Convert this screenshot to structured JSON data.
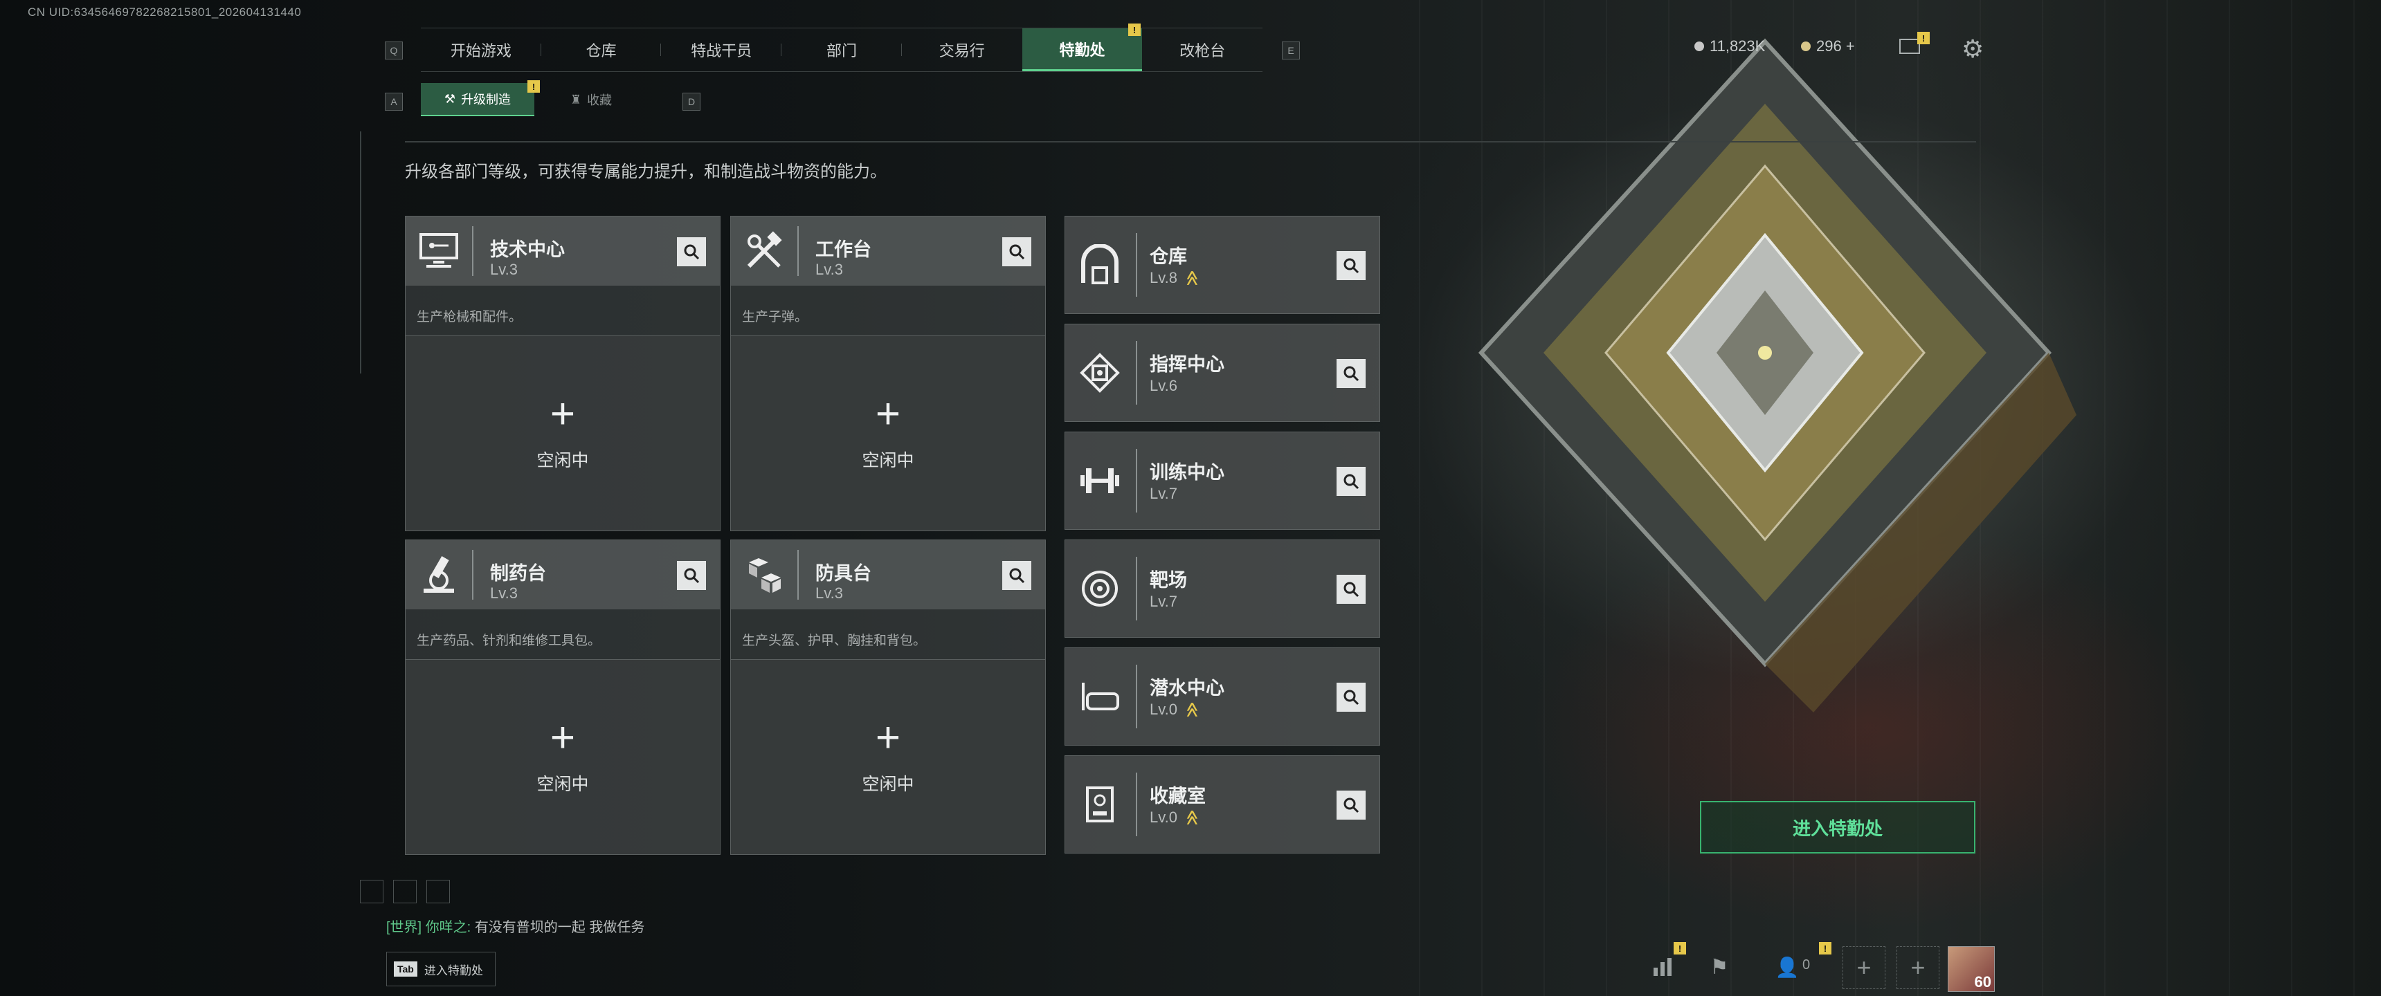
{
  "uid_text": "CN UID:63456469782268215801_202604131440",
  "nav": {
    "left_key": "Q",
    "right_key": "E",
    "tabs": [
      "开始游戏",
      "仓库",
      "特战干员",
      "部门",
      "交易行",
      "特勤处",
      "改枪台"
    ],
    "active_tab": "特勤处",
    "badge": "!"
  },
  "subnav": {
    "left_key": "A",
    "right_key": "D",
    "tabs": [
      "升级制造",
      "收藏"
    ],
    "badge": "!"
  },
  "description": "升级各部门等级，可获得专属能力提升，和制造战斗物资的能力。",
  "craft_stations": [
    {
      "name": "技术中心",
      "level": "Lv.3",
      "note": "生产枪械和配件。",
      "icon": "monitor-icon",
      "slot": "空闲中"
    },
    {
      "name": "工作台",
      "level": "Lv.3",
      "note": "生产子弹。",
      "icon": "tools-icon",
      "slot": "空闲中"
    },
    {
      "name": "制药台",
      "level": "Lv.3",
      "note": "生产药品、针剂和维修工具包。",
      "icon": "microscope-icon",
      "slot": "空闲中"
    },
    {
      "name": "防具台",
      "level": "Lv.3",
      "note": "生产头盔、护甲、胸挂和背包。",
      "icon": "cubes-icon",
      "slot": "空闲中"
    }
  ],
  "facilities": [
    {
      "name": "仓库",
      "level": "Lv.8",
      "upgrade": true,
      "icon": "warehouse-icon"
    },
    {
      "name": "指挥中心",
      "level": "Lv.6",
      "upgrade": false,
      "icon": "chip-icon"
    },
    {
      "name": "训练中心",
      "level": "Lv.7",
      "upgrade": false,
      "icon": "dumbbell-icon"
    },
    {
      "name": "靶场",
      "level": "Lv.7",
      "upgrade": false,
      "icon": "target-icon"
    },
    {
      "name": "潜水中心",
      "level": "Lv.0",
      "upgrade": true,
      "icon": "diving-mask-icon"
    },
    {
      "name": "收藏室",
      "level": "Lv.0",
      "upgrade": true,
      "icon": "trophy-case-icon"
    }
  ],
  "upgrade_symbol": "≪",
  "resources": {
    "currency_a": "11,823K",
    "currency_b": "296 +"
  },
  "enter_button": "进入特勤处",
  "chat": {
    "channel": "[世界]",
    "sender": "你咩之:",
    "message": "有没有普坝的一起 我做任务"
  },
  "tab_hint": {
    "key": "Tab",
    "label": "进入特勤处"
  },
  "bottom": {
    "friends_count": "0",
    "player_level": "60"
  },
  "colors": {
    "accent_green": "#5fd28f",
    "active_tab_bg": "#2c5c43",
    "badge_yellow": "#e6c84a"
  }
}
